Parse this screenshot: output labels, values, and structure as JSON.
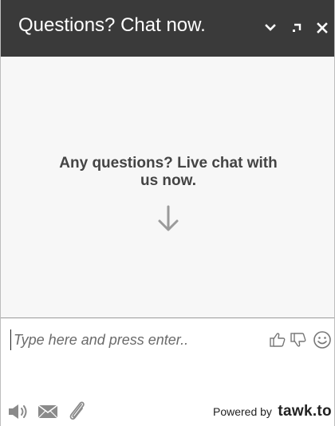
{
  "header": {
    "title": "Questions? Chat now.",
    "minimize_icon": "chevron-down-icon",
    "popout_icon": "popout-icon",
    "close_icon": "close-icon",
    "background_color": "#3a3a3a"
  },
  "conversation": {
    "prompt": "Any questions? Live chat with us now.",
    "arrow_icon": "arrow-down-icon"
  },
  "composer": {
    "placeholder": "Type here and press enter..",
    "rating_icons": [
      "thumbs-up-icon",
      "thumbs-down-icon"
    ],
    "emoji_icon": "smiley-icon"
  },
  "toolbar": {
    "icons": [
      "speaker-icon",
      "envelope-icon",
      "paperclip-icon"
    ]
  },
  "footer": {
    "powered_by": "Powered by",
    "brand": "tawk.to"
  }
}
